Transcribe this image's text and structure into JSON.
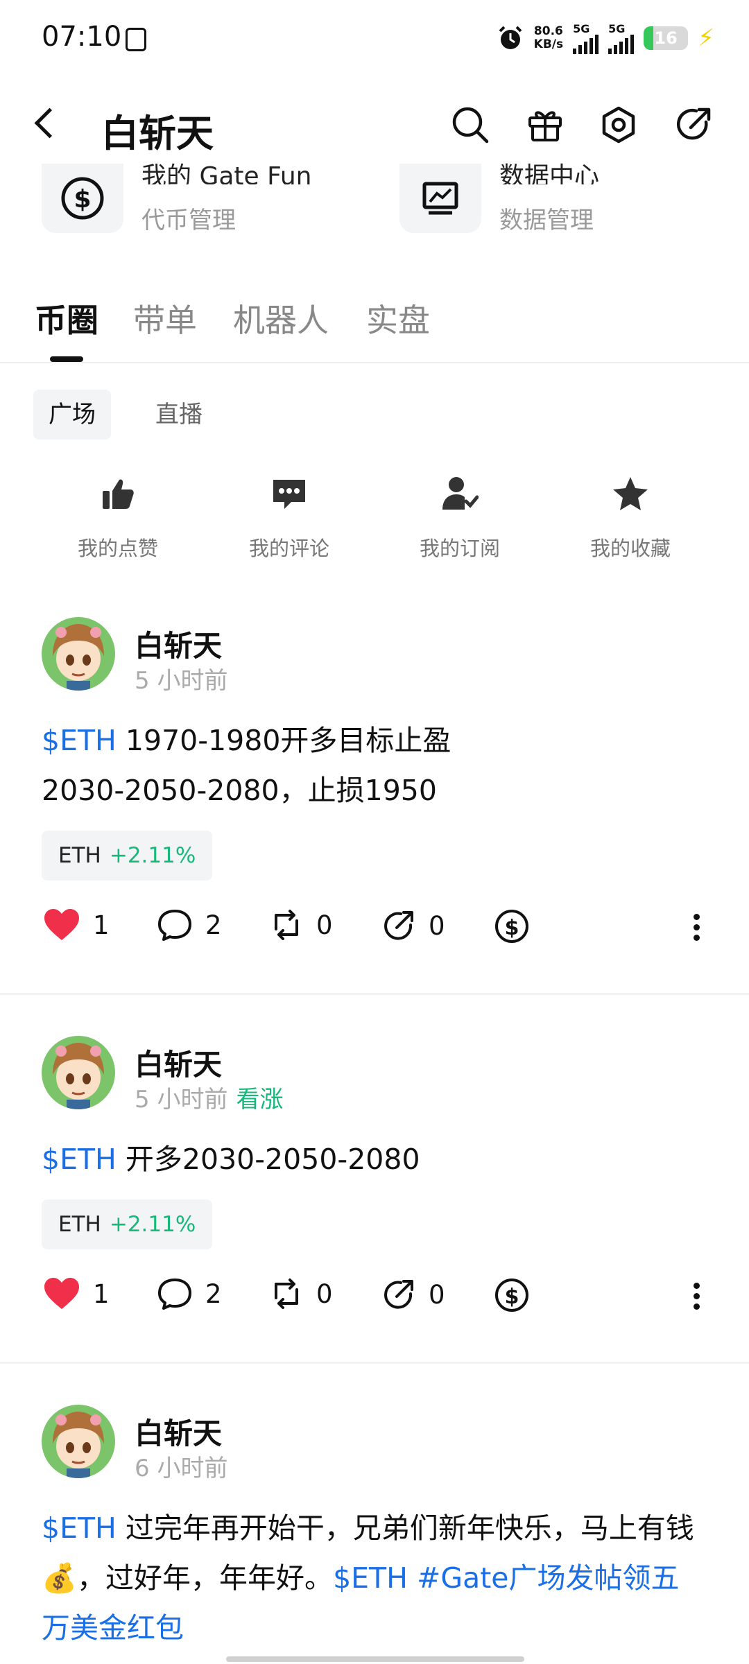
{
  "status_bar": {
    "time": "07:10",
    "net_speed_value": "80.6",
    "net_speed_unit": "KB/s",
    "signal1_label": "5G",
    "signal2_label": "5G",
    "battery": "16"
  },
  "header": {
    "title": "白斩天",
    "icons": [
      "back-icon",
      "search-icon",
      "gift-icon",
      "settings-icon",
      "share-icon"
    ]
  },
  "shortcuts": [
    {
      "title": "我的 Gate Fun",
      "subtitle": "代币管理",
      "icon": "dollar-circle-icon"
    },
    {
      "title": "数据中心",
      "subtitle": "数据管理",
      "icon": "chart-monitor-icon"
    }
  ],
  "tabs": [
    "币圈",
    "带单",
    "机器人",
    "实盘"
  ],
  "active_tab": 0,
  "sub_tabs": [
    "广场",
    "直播"
  ],
  "active_sub_tab": 0,
  "quick_actions": [
    {
      "label": "我的点赞",
      "icon": "thumbs-up-icon"
    },
    {
      "label": "我的评论",
      "icon": "comment-icon"
    },
    {
      "label": "我的订阅",
      "icon": "subscribe-icon"
    },
    {
      "label": "我的收藏",
      "icon": "star-icon"
    }
  ],
  "posts": [
    {
      "author": "白斩天",
      "time": "5 小时前",
      "sentiment": "",
      "tag": "$ETH",
      "text": "1970-1980开多目标止盈2030-2050-2080，止损1950",
      "tail": "",
      "ticker": "ETH",
      "change": "+2.11%",
      "likes": "1",
      "comments": "2",
      "reposts": "0",
      "shares": "0"
    },
    {
      "author": "白斩天",
      "time": "5 小时前",
      "sentiment": "看涨",
      "tag": "$ETH",
      "text": "开多2030-2050-2080",
      "tail": "",
      "ticker": "ETH",
      "change": "+2.11%",
      "likes": "1",
      "comments": "2",
      "reposts": "0",
      "shares": "0"
    },
    {
      "author": "白斩天",
      "time": "6 小时前",
      "sentiment": "",
      "tag": "$ETH",
      "text": "过完年再开始干，兄弟们新年快乐，马上有钱💰，过好年，年年好。",
      "tail": "$ETH #Gate广场发帖领五万美金红包"
    }
  ],
  "colors": {
    "accent_blue": "#1a6fe6",
    "positive_green": "#16b979",
    "like_red": "#f0304a"
  }
}
